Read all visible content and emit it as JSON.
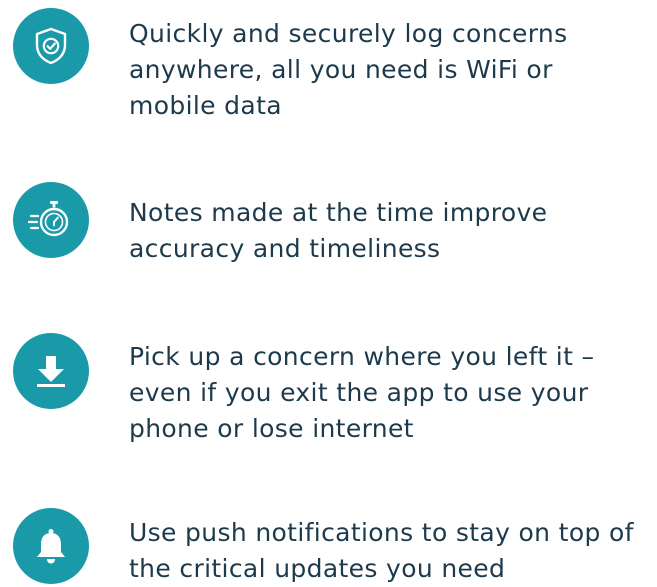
{
  "accent_color": "#1a9aa8",
  "text_color": "#1d3a4c",
  "features": [
    {
      "icon": "shield-check-icon",
      "text": "Quickly and securely log concerns anywhere, all you need is WiFi or mobile data"
    },
    {
      "icon": "stopwatch-icon",
      "text": "Notes made at the time improve accuracy and timeliness"
    },
    {
      "icon": "download-icon",
      "text": "Pick up a concern where you left it – even if you exit the app to use your phone or lose internet"
    },
    {
      "icon": "bell-icon",
      "text": "Use push notifications to stay on top of the critical updates you need"
    }
  ]
}
